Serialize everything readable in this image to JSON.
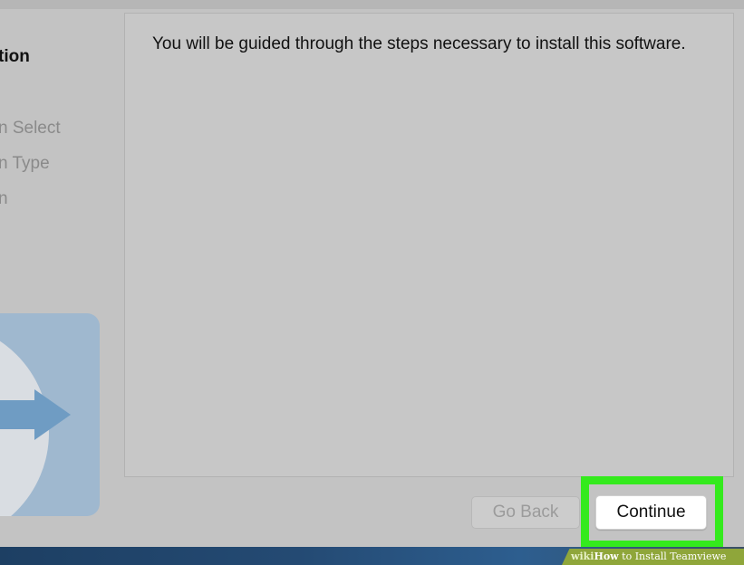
{
  "sidebar": {
    "steps": [
      {
        "label": "tion"
      },
      {
        "label": "n Select"
      },
      {
        "label": "n Type"
      },
      {
        "label": "n"
      }
    ]
  },
  "content": {
    "intro_text": "You will be guided through the steps necessary to install this software."
  },
  "buttons": {
    "go_back_label": "Go Back",
    "continue_label": "Continue"
  },
  "watermark": {
    "wiki": "wiki",
    "how": "How",
    "rest": " to Install Teamviewe"
  },
  "colors": {
    "highlight": "#34ea1d",
    "logo_tile": "#9fb8cf",
    "logo_arrow": "#6f9cc3"
  },
  "icons": {
    "app_logo": "teamviewer-arrow-icon"
  }
}
